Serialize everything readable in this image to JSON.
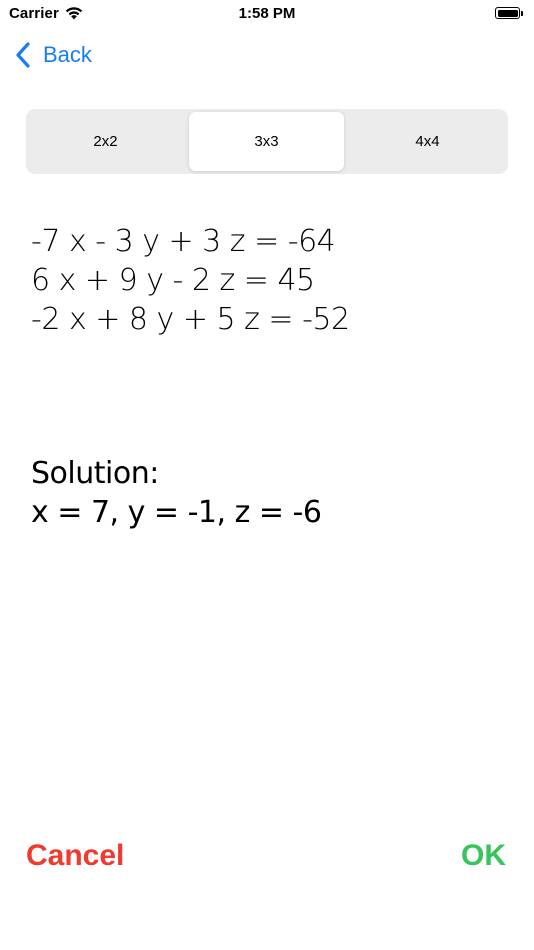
{
  "status_bar": {
    "carrier": "Carrier",
    "time": "1:58 PM",
    "icons": [
      "wifi-icon",
      "battery-icon"
    ]
  },
  "nav": {
    "back_label": "Back",
    "back_icon": "chevron-left-icon",
    "accent_color": "#1a7cf5"
  },
  "segmented": {
    "options": [
      "2x2",
      "3x3",
      "4x4"
    ],
    "selected": "3x3"
  },
  "equations": [
    "-7 x - 3 y + 3 z = -64",
    "6 x + 9 y - 2 z = 45",
    "-2 x + 8 y + 5 z = -52"
  ],
  "solution": {
    "title": "Solution:",
    "value": "x = 7, y = -1, z = -6"
  },
  "actions": {
    "cancel_label": "Cancel",
    "cancel_color": "#f03a2e",
    "ok_label": "OK",
    "ok_color": "#36c45b"
  }
}
